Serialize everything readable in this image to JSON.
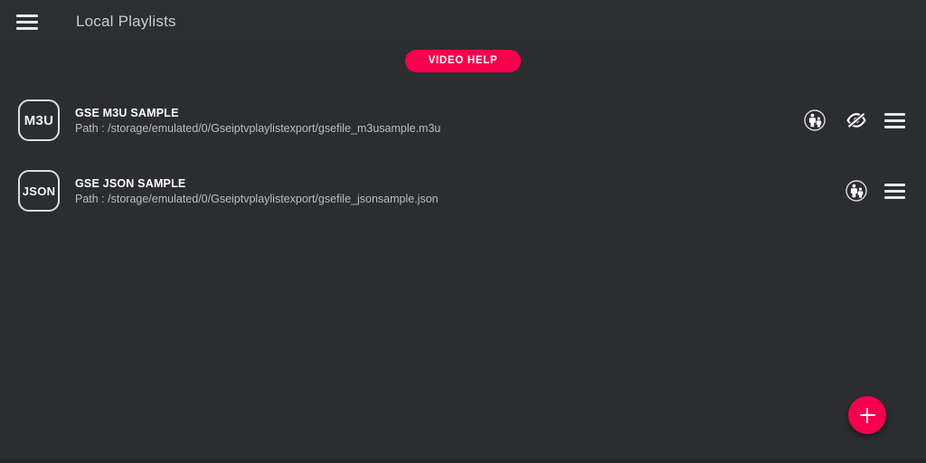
{
  "appbar": {
    "menu_icon": "hamburger-menu-icon",
    "title": "Local Playlists"
  },
  "toolbar": {
    "video_help_label": "VIDEO HELP"
  },
  "colors": {
    "accent": "#f7004b",
    "background": "#2b2d31",
    "appbar_background": "#2c2e32",
    "primary_text": "#ffffff",
    "secondary_text": "#b9bcc1",
    "title_text": "#c9cbcf",
    "bottom_strip": "#232529"
  },
  "playlists": [
    {
      "badge": "M3U",
      "title": "GSE M3U SAMPLE",
      "path": "Path : /storage/emulated/0/Gseiptvplaylistexport/gsefile_m3usample.m3u",
      "actions": {
        "parental": "parental-control-icon",
        "hide": "eye-off-icon",
        "menu": "row-menu-icon"
      },
      "has_hide_action": true
    },
    {
      "badge": "JSON",
      "title": "GSE JSON SAMPLE",
      "path": "Path : /storage/emulated/0/Gseiptvplaylistexport/gsefile_jsonsample.json",
      "actions": {
        "parental": "parental-control-icon",
        "menu": "row-menu-icon"
      },
      "has_hide_action": false
    }
  ],
  "fab": {
    "icon": "plus-icon",
    "label": "+"
  }
}
